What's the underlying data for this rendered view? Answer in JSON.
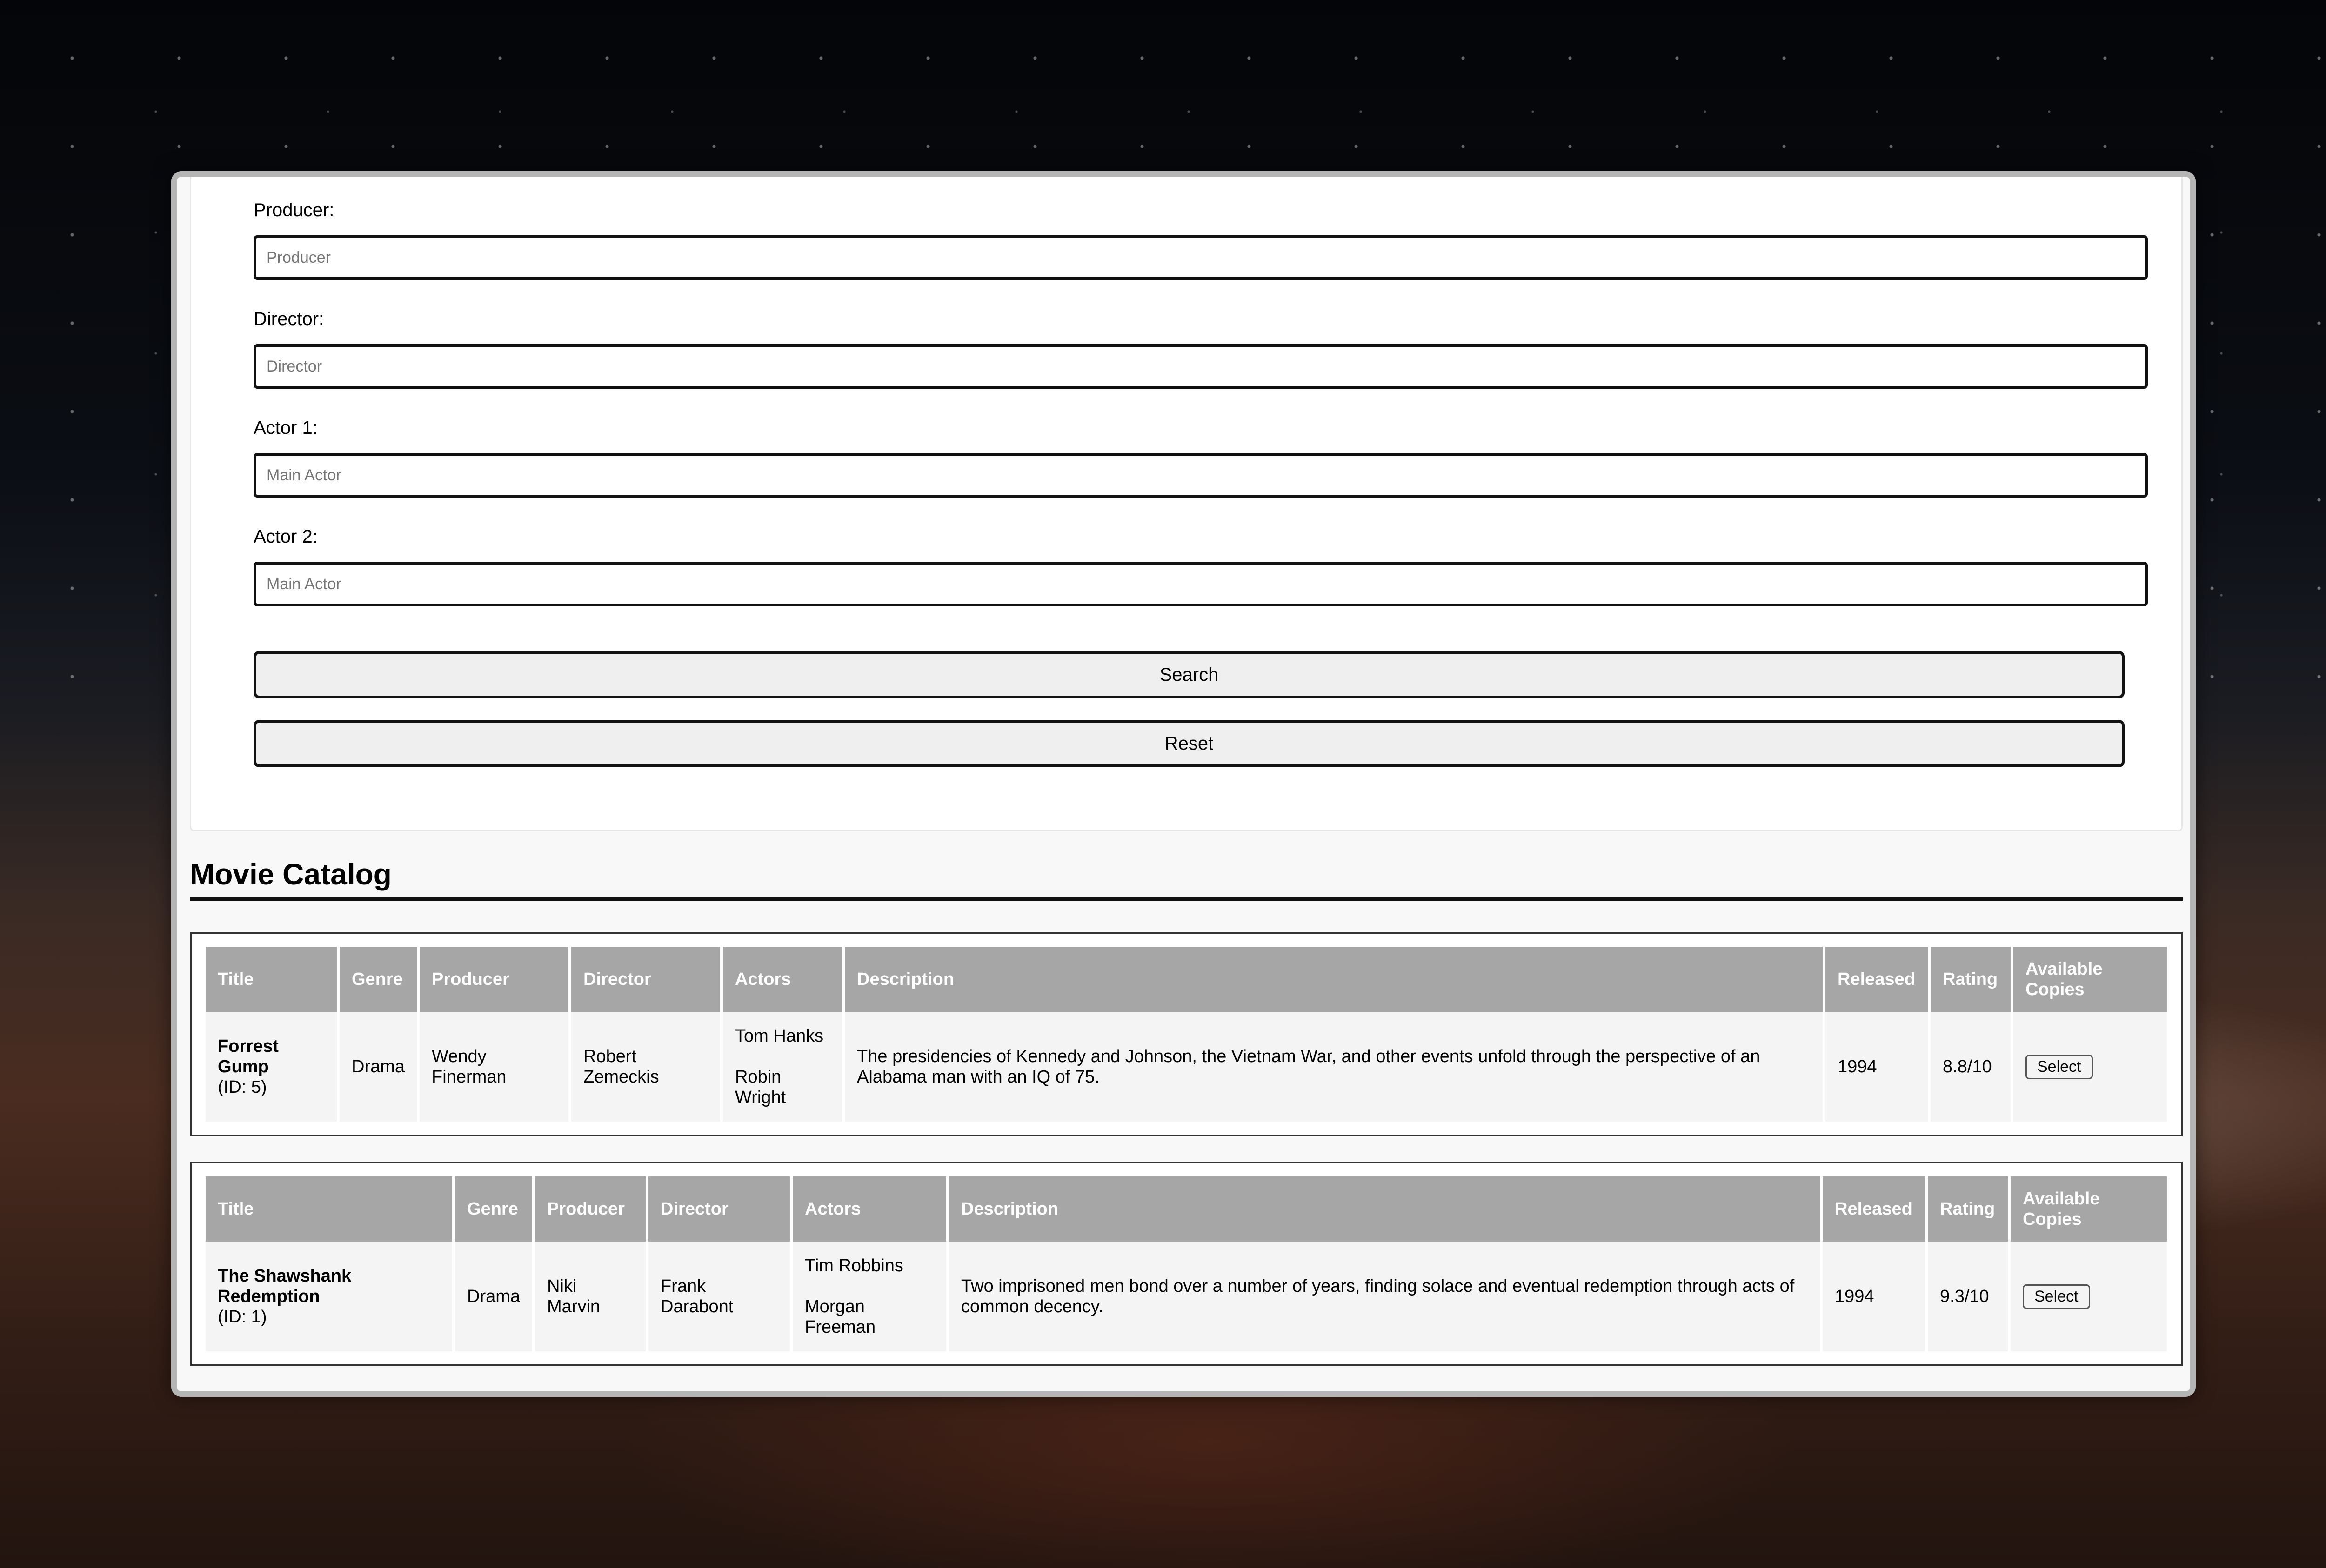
{
  "form": {
    "fields": [
      {
        "label": "Producer:",
        "placeholder": "Producer"
      },
      {
        "label": "Director:",
        "placeholder": "Director"
      },
      {
        "label": "Actor 1:",
        "placeholder": "Main Actor"
      },
      {
        "label": "Actor 2:",
        "placeholder": "Main Actor"
      }
    ],
    "search_label": "Search",
    "reset_label": "Reset"
  },
  "catalog": {
    "title": "Movie Catalog",
    "columns": [
      "Title",
      "Genre",
      "Producer",
      "Director",
      "Actors",
      "Description",
      "Released",
      "Rating",
      "Available Copies"
    ],
    "movies": [
      {
        "title": "Forrest Gump",
        "id_text": "(ID: 5)",
        "genre": "Drama",
        "producer": "Wendy Finerman",
        "director": "Robert Zemeckis",
        "actor1": "Tom Hanks",
        "actor2": "Robin Wright",
        "description": "The presidencies of Kennedy and Johnson, the Vietnam War, and other events unfold through the perspective of an Alabama man with an IQ of 75.",
        "released": "1994",
        "rating": "8.8/10",
        "select_label": "Select"
      },
      {
        "title": "The Shawshank Redemption",
        "id_text": "(ID: 1)",
        "genre": "Drama",
        "producer": "Niki Marvin",
        "director": "Frank Darabont",
        "actor1": "Tim Robbins",
        "actor2": "Morgan Freeman",
        "description": "Two imprisoned men bond over a number of years, finding solace and eventual redemption through acts of common decency.",
        "released": "1994",
        "rating": "9.3/10",
        "select_label": "Select"
      }
    ]
  }
}
